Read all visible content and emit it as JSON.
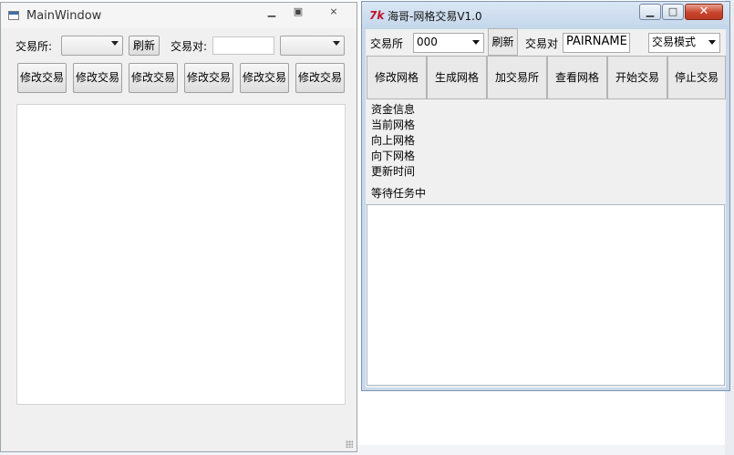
{
  "main_window": {
    "title": "MainWindow",
    "exchange_label": "交易所:",
    "refresh_button": "刷新",
    "pair_label": "交易对:",
    "buttons": [
      "修改交易",
      "修改交易",
      "修改交易",
      "修改交易",
      "修改交易",
      "修改交易"
    ]
  },
  "grid_window": {
    "logo": "7k",
    "title": "海哥-网格交易V1.0",
    "exchange_label": "交易所",
    "exchange_value": "000",
    "refresh_button": "刷新",
    "pair_label": "交易对",
    "pair_value": "PAIRNAME",
    "mode_value": "交易模式",
    "buttons": [
      "修改网格",
      "生成网格",
      "加交易所",
      "查看网格",
      "开始交易",
      "停止交易"
    ],
    "info_lines": [
      "资金信息",
      "当前网格",
      "向上网格",
      "向下网格",
      "更新时间"
    ],
    "status": "等待任务中"
  }
}
